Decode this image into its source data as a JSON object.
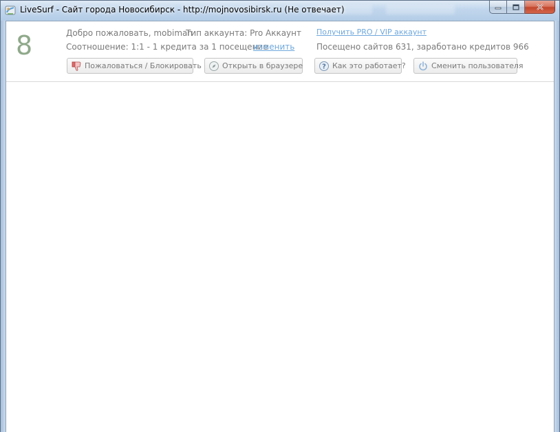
{
  "window": {
    "title": "LiveSurf - Сайт города Новосибирск - http://mojnovosibirsk.ru (Не отвечает)",
    "icon": "livesurf-app-icon",
    "caption_buttons": [
      "minimize-icon",
      "maximize-icon",
      "close-icon"
    ]
  },
  "header": {
    "counter": "8",
    "welcome": "Добро пожаловать, mobiman",
    "account_type": "Тип аккаунта: Pro Аккаунт",
    "ratio": "Соотношение: 1:1 - 1 кредита за 1 посещение",
    "change_link": "изменить",
    "get_pro_link": "Получить PRO / VIP аккаунт",
    "stats": "Посещено сайтов 631, заработано кредитов 966"
  },
  "toolbar": {
    "complain_label": "Пожаловаться / Блокировать",
    "open_browser_label": "Открыть в браузере",
    "how_it_works_label": "Как это работает?",
    "switch_user_label": "Сменить пользователя"
  },
  "colors": {
    "counter": "#8fa98a",
    "link": "#6fa8dc",
    "text_muted": "#7a7a7a",
    "close_button": "#c2452b"
  }
}
